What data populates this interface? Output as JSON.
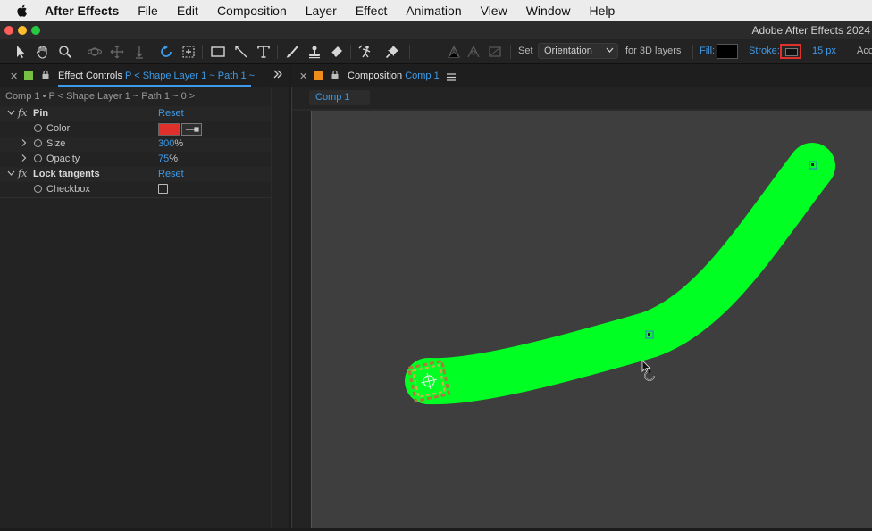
{
  "menubar": {
    "app_name": "After Effects",
    "items": [
      "File",
      "Edit",
      "Composition",
      "Layer",
      "Effect",
      "Animation",
      "View",
      "Window",
      "Help"
    ]
  },
  "window": {
    "title": "Adobe After Effects 2024"
  },
  "toolbar": {
    "tools": [
      "selection-tool",
      "hand-tool",
      "zoom-tool",
      "orbit-tool",
      "pan-tool",
      "dolly-tool",
      "rotation-tool",
      "pan-behind-tool",
      "rectangle-tool",
      "pen-tool",
      "type-tool",
      "brush-tool",
      "clone-stamp-tool",
      "eraser-tool",
      "roto-brush-tool",
      "puppet-pin-tool"
    ],
    "set_label": "Set",
    "set_value": "Orientation",
    "for_3d_label": "for 3D layers",
    "fill_label": "Fill:",
    "stroke_label": "Stroke:",
    "stroke_width": "15 px",
    "trailing": "Acc",
    "fill_color": "#000000",
    "stroke_color": "#e0302c"
  },
  "effect_controls": {
    "tab_label": "Effect Controls",
    "tab_target": "P < Shape Layer 1 ~ Path 1 ~",
    "breadcrumb": "Comp 1 • P < Shape Layer 1 ~ Path 1 ~ 0 >",
    "properties": [
      {
        "kind": "effect",
        "name": "Pin",
        "value": "Reset"
      },
      {
        "kind": "prop",
        "name": "Color",
        "value": "",
        "color": "#e0302c"
      },
      {
        "kind": "prop-expand",
        "name": "Size",
        "value": "300",
        "unit": "%"
      },
      {
        "kind": "prop-expand",
        "name": "Opacity",
        "value": "75",
        "unit": "%"
      },
      {
        "kind": "effect",
        "name": "Lock tangents",
        "value": "Reset"
      },
      {
        "kind": "checkbox",
        "name": "Checkbox",
        "value": ""
      }
    ]
  },
  "composition": {
    "tab_label": "Composition",
    "tab_name": "Comp 1",
    "subtab": "Comp 1",
    "stroke_color": "#00ff22",
    "viewer_bg": "#3e3e3e"
  }
}
